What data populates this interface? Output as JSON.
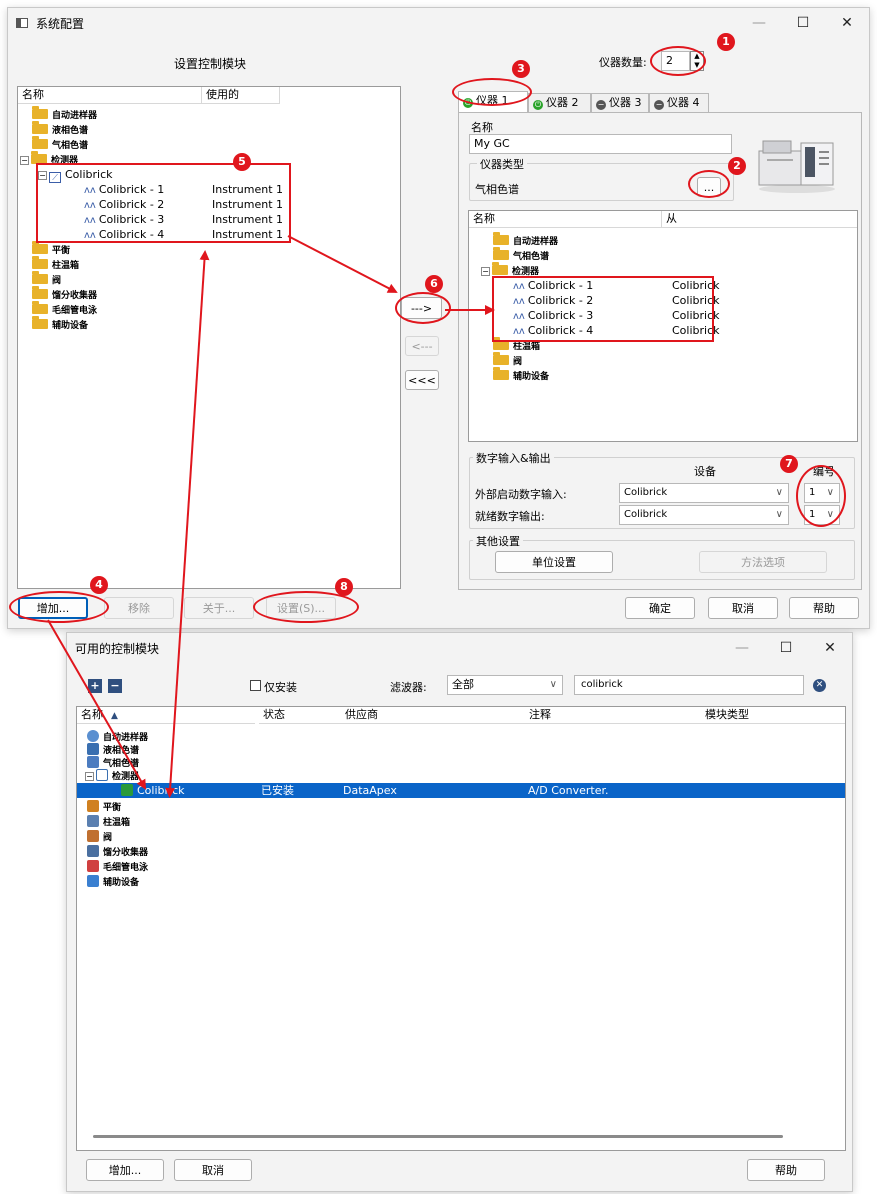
{
  "main": {
    "title": "系统配置",
    "left_heading": "设置控制模块",
    "left_cols": [
      "名称",
      "使用的"
    ],
    "left_tree": [
      {
        "label": "自动进样器",
        "type": "folder"
      },
      {
        "label": "液相色谱",
        "type": "folder"
      },
      {
        "label": "气相色谱",
        "type": "folder"
      },
      {
        "label": "检测器",
        "type": "folder"
      },
      {
        "label": "Colibrick",
        "type": "module"
      },
      {
        "label": "Colibrick - 1",
        "used": "Instrument 1"
      },
      {
        "label": "Colibrick - 2",
        "used": "Instrument 1"
      },
      {
        "label": "Colibrick - 3",
        "used": "Instrument 1"
      },
      {
        "label": "Colibrick - 4",
        "used": "Instrument 1"
      },
      {
        "label": "平衡",
        "type": "folder"
      },
      {
        "label": "柱温箱",
        "type": "folder"
      },
      {
        "label": "阀",
        "type": "folder"
      },
      {
        "label": "馏分收集器",
        "type": "folder"
      },
      {
        "label": "毛细管电泳",
        "type": "folder"
      },
      {
        "label": "辅助设备",
        "type": "folder"
      }
    ],
    "instrument_count_label": "仪器数量:",
    "instrument_count": "2",
    "tabs": [
      "仪器 1",
      "仪器 2",
      "仪器 3",
      "仪器 4"
    ],
    "name_label": "名称",
    "name_value": "My GC",
    "type_group": "仪器类型",
    "type_value": "气相色谱",
    "browse": "...",
    "right_cols": [
      "名称",
      "从"
    ],
    "right_tree": [
      {
        "label": "自动进样器"
      },
      {
        "label": "气相色谱"
      },
      {
        "label": "检测器"
      },
      {
        "label": "Colibrick - 1",
        "from": "Colibrick"
      },
      {
        "label": "Colibrick - 2",
        "from": "Colibrick"
      },
      {
        "label": "Colibrick - 3",
        "from": "Colibrick"
      },
      {
        "label": "Colibrick - 4",
        "from": "Colibrick"
      },
      {
        "label": "柱温箱"
      },
      {
        "label": "阀"
      },
      {
        "label": "辅助设备"
      }
    ],
    "move_right": "--->",
    "move_left": "<---",
    "move_all_left": "<<<",
    "dio_group": "数字输入&输出",
    "dio_device_hdr": "设备",
    "dio_num_hdr": "编号",
    "dio_in_label": "外部启动数字输入:",
    "dio_in_device": "Colibrick",
    "dio_in_num": "1",
    "dio_out_label": "就绪数字输出:",
    "dio_out_device": "Colibrick",
    "dio_out_num": "1",
    "other_group": "其他设置",
    "unit_btn": "单位设置",
    "method_btn": "方法选项",
    "add_btn": "增加...",
    "remove_btn": "移除",
    "about_btn": "关于...",
    "settings_btn": "设置(S)...",
    "ok_btn": "确定",
    "cancel_btn": "取消",
    "help_btn": "帮助"
  },
  "modules": {
    "title": "可用的控制模块",
    "installed_only": "仅安装",
    "filter_label": "滤波器:",
    "filter_value": "全部",
    "search_value": "colibrick",
    "cols": [
      "名称",
      "状态",
      "供应商",
      "注释",
      "模块类型"
    ],
    "sort_arrow": "▲",
    "tree": [
      {
        "label": "自动进样器",
        "color": "#5a8fd0"
      },
      {
        "label": "液相色谱",
        "color": "#3a6fb0"
      },
      {
        "label": "气相色谱",
        "color": "#4c7cc0"
      },
      {
        "label": "检测器",
        "color": "#3a6fb0"
      },
      {
        "label": "Colibrick",
        "status": "已安装",
        "vendor": "DataApex",
        "note": "A/D Converter.",
        "color": "#2a9a3a"
      },
      {
        "label": "平衡",
        "color": "#d08020"
      },
      {
        "label": "柱温箱",
        "color": "#5a7fb0"
      },
      {
        "label": "阀",
        "color": "#c07030"
      },
      {
        "label": "馏分收集器",
        "color": "#4a6fa0"
      },
      {
        "label": "毛细管电泳",
        "color": "#d04040"
      },
      {
        "label": "辅助设备",
        "color": "#3a7fd0"
      }
    ],
    "add_btn": "增加...",
    "cancel_btn": "取消",
    "help_btn": "帮助"
  },
  "annotations": [
    "1",
    "2",
    "3",
    "4",
    "5",
    "6",
    "7",
    "8"
  ]
}
